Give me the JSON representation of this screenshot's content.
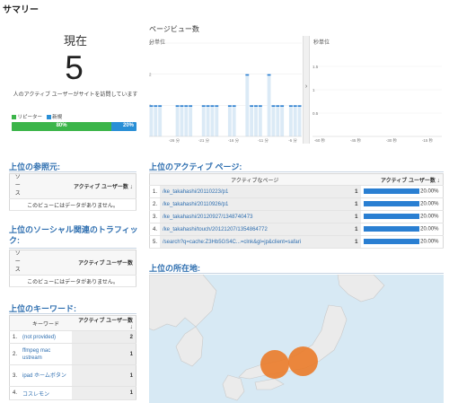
{
  "summary_title": "サマリー",
  "now": {
    "label": "現在",
    "count": "5",
    "desc": "人のアクティブ ユーザーがサイトを訪問しています",
    "legend_repeat": "リピーター",
    "legend_new": "新規",
    "repeat_pct": "80%",
    "new_pct": "20%",
    "repeat_fraction": 0.8,
    "colors": {
      "repeat": "#3cb54a",
      "new": "#2a8fd6"
    }
  },
  "pageviews": {
    "title": "ページビュー数",
    "per_minute_label": "分単位",
    "per_second_label": "秒単位",
    "minute_y_ticks": [
      "3",
      "2",
      "1"
    ],
    "minute_x_ticks": [
      "-26 分",
      "-21 分",
      "-16 分",
      "-11 分",
      "-6 分"
    ],
    "second_y_ticks": [
      "1.5",
      "1",
      "0.5"
    ],
    "second_x_ticks": [
      "-60 秒",
      "-45 秒",
      "-30 秒",
      "-15 秒"
    ]
  },
  "chart_data": [
    {
      "type": "bar",
      "title": "分単位",
      "x_ticks": [
        "-26 分",
        "-21 分",
        "-16 分",
        "-11 分",
        "-6 分"
      ],
      "ylim": [
        0,
        3
      ],
      "values": [
        1,
        1,
        1,
        0,
        0,
        0,
        1,
        1,
        1,
        1,
        0,
        0,
        1,
        1,
        1,
        1,
        0,
        0,
        1,
        1,
        0,
        0,
        2,
        1,
        1,
        1,
        0,
        2,
        1,
        1,
        1,
        0,
        1,
        1,
        1
      ],
      "color": "#2a7fd2"
    },
    {
      "type": "bar",
      "title": "秒単位",
      "x_ticks": [
        "-60 秒",
        "-45 秒",
        "-30 秒",
        "-15 秒"
      ],
      "ylim": [
        0,
        1.5
      ],
      "values": []
    }
  ],
  "referrals": {
    "title": "上位の参照元:",
    "col_source": "ソース",
    "col_users": "アクティブ ユーザー数",
    "empty": "このビューにはデータがありません。"
  },
  "social": {
    "title": "上位のソーシャル関連のトラフィック:",
    "col_source": "ソース",
    "col_users": "アクティブ ユーザー数",
    "empty": "このビューにはデータがありません。"
  },
  "keywords": {
    "title": "上位のキーワード:",
    "col_keyword": "キーワード",
    "col_users": "アクティブ ユーザー数",
    "rows": [
      {
        "idx": "1.",
        "keyword": "(not provided)",
        "users": "2"
      },
      {
        "idx": "2.",
        "keyword": "ffmpeg mac ustream",
        "users": "1"
      },
      {
        "idx": "3.",
        "keyword": "ipad ホームボタン",
        "users": "1"
      },
      {
        "idx": "4.",
        "keyword": "コスレモン",
        "users": "1"
      }
    ]
  },
  "active_pages": {
    "title": "上位のアクティブ ページ:",
    "col_page": "アクティブなページ",
    "col_users": "アクティブ ユーザー数",
    "rows": [
      {
        "idx": "1.",
        "page": "/ke_takahashi/20110223/p1",
        "users": "1",
        "pct": "20.00%"
      },
      {
        "idx": "2.",
        "page": "/ke_takahashi/20110926/p1",
        "users": "1",
        "pct": "20.00%"
      },
      {
        "idx": "3.",
        "page": "/ke_takahashi/20120927/1348740473",
        "users": "1",
        "pct": "20.00%"
      },
      {
        "idx": "4.",
        "page": "/ke_takahashi/touch/20121207/1354864772",
        "users": "1",
        "pct": "20.00%"
      },
      {
        "idx": "5.",
        "page": "/search?q=cache:Z3Hb5GS4C...=clnk&gl=jp&client=safari",
        "users": "1",
        "pct": "20.00%"
      }
    ]
  },
  "locations": {
    "title": "上位の所在地:",
    "markers": [
      {
        "label": "marker-1"
      },
      {
        "label": "marker-2"
      }
    ],
    "colors": {
      "sea": "#d7e9f4",
      "land": "#ebebeb",
      "marker": "#ea7d2c"
    }
  }
}
